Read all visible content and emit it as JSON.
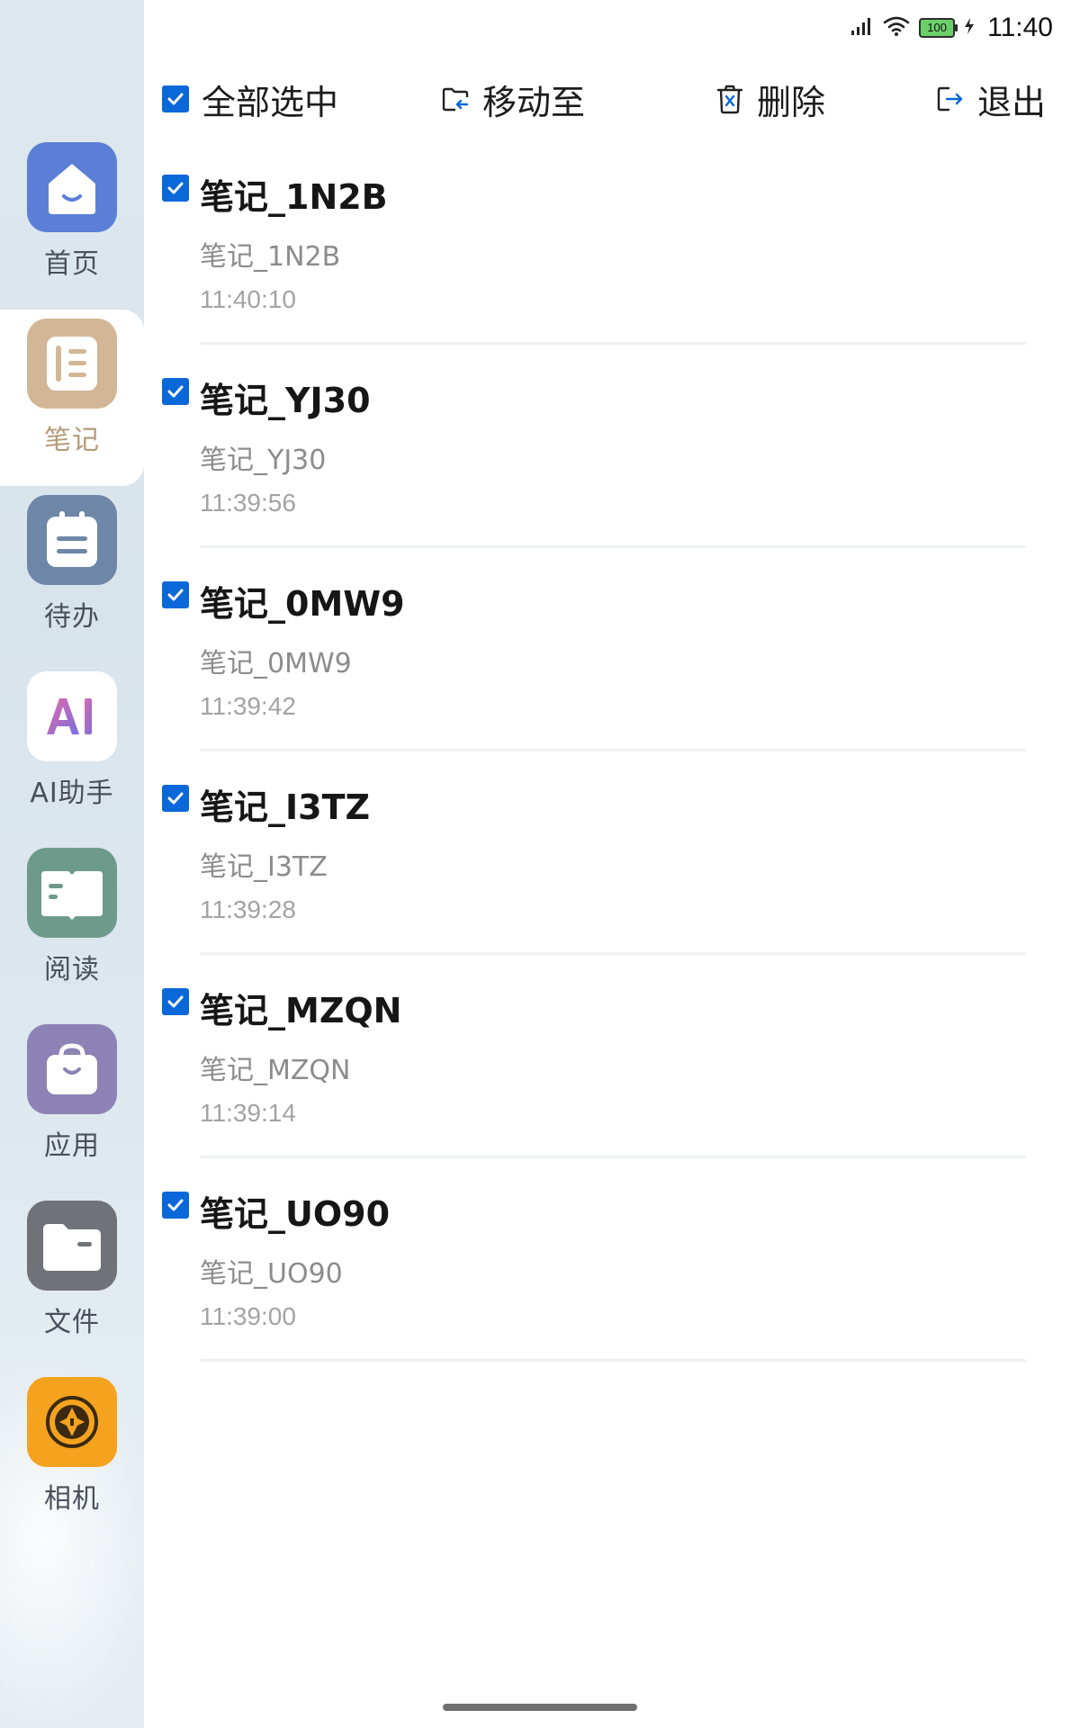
{
  "status": {
    "time": "11:40",
    "battery": "100"
  },
  "toolbar": {
    "select_all": "全部选中",
    "move_to": "移动至",
    "delete": "删除",
    "exit": "退出"
  },
  "sidebar": {
    "items": [
      {
        "label": "首页",
        "icon": "home-icon",
        "color": "#5b7fd6"
      },
      {
        "label": "笔记",
        "icon": "notes-icon",
        "color": "#d2b695"
      },
      {
        "label": "待办",
        "icon": "todo-icon",
        "color": "#6e86a8"
      },
      {
        "label": "AI助手",
        "icon": "ai-icon",
        "color": "#ffffff"
      },
      {
        "label": "阅读",
        "icon": "book-icon",
        "color": "#6e9a8c"
      },
      {
        "label": "应用",
        "icon": "apps-icon",
        "color": "#8d82b5"
      },
      {
        "label": "文件",
        "icon": "folder-icon",
        "color": "#6f7378"
      },
      {
        "label": "相机",
        "icon": "camera-icon",
        "color": "#f5a21f"
      }
    ]
  },
  "notes": [
    {
      "title": "笔记_1N2B",
      "preview": "笔记_1N2B",
      "time": "11:40:10",
      "checked": true
    },
    {
      "title": "笔记_YJ30",
      "preview": "笔记_YJ30",
      "time": "11:39:56",
      "checked": true
    },
    {
      "title": "笔记_0MW9",
      "preview": "笔记_0MW9",
      "time": "11:39:42",
      "checked": true
    },
    {
      "title": "笔记_I3TZ",
      "preview": "笔记_I3TZ",
      "time": "11:39:28",
      "checked": true
    },
    {
      "title": "笔记_MZQN",
      "preview": "笔记_MZQN",
      "time": "11:39:14",
      "checked": true
    },
    {
      "title": "笔记_UO90",
      "preview": "笔记_UO90",
      "time": "11:39:00",
      "checked": true
    }
  ],
  "colors": {
    "accent": "#0a68d8",
    "active_nav_label": "#b59a7a"
  }
}
